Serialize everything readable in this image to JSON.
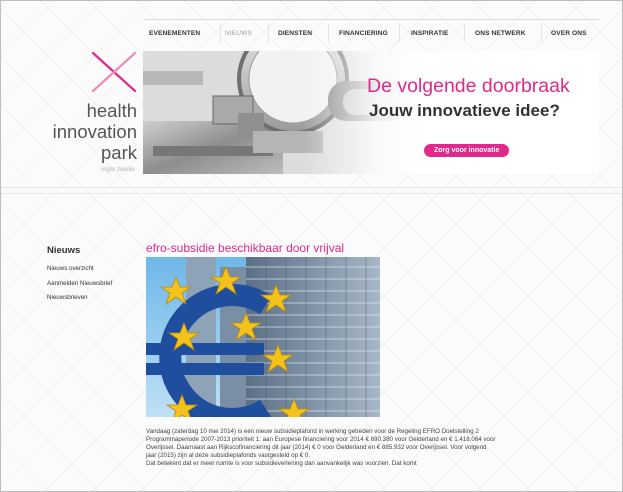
{
  "nav": {
    "items": [
      "EVENEMENTEN",
      "NIEUWS",
      "DIENSTEN",
      "FINANCIERING",
      "INSPIRATIE",
      "ONS NETWERK",
      "OVER ONS"
    ],
    "active": "NIEUWS"
  },
  "logo": {
    "lines": [
      "health",
      "innovation",
      "park"
    ],
    "tagline": "regio zwolle",
    "icon": "x-cross-logo-icon",
    "color": "#e0298a"
  },
  "banner": {
    "headline": "De volgende doorbraak",
    "subheadline": "Jouw innovatieve idee?",
    "cta_label": "Zorg voor innovatie",
    "accent": "#e0298a"
  },
  "sidebar": {
    "title": "Nieuws",
    "links": [
      "Nieuws overzicht",
      "Aanmelden Nieuwsbrief",
      "Nieuwsbrieven"
    ]
  },
  "article": {
    "title": "efro-subsidie beschikbaar door vrijval",
    "paragraph1": "Vandaag (zaterdag 10 mei 2014) is een nieuw subsidieplafond in werking getreden voor de Regeling EFRO Doelstelling 2 Programmaperiode 2007-2013 prioriteit 1: aan Europese financiering voor 2014 € 690.380 voor Gelderland en € 1.418.064 voor Overijssel. Daarnaast aan Rijkscofinanciering dit jaar (2014) € 0 voor Gelderland en € 885.932 voor Overijssel. Voor volgend jaar (2015) zijn al deze subsidieplafonds vastgesteld op € 0.",
    "paragraph2": "Dat betekent dat er meer ruimte is voor subsidieverlening dan aanvankelijk was voorzien. Dat komt",
    "image_icon": "euro-sign-sculpture-image"
  }
}
